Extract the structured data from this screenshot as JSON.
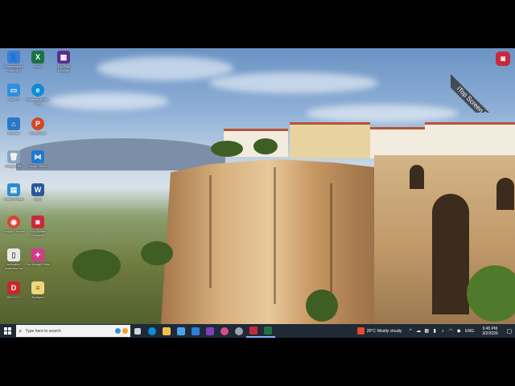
{
  "desktop": {
    "icons": [
      {
        "label": "Wondershare Filmora 9",
        "glyph": "👤",
        "color": "#3a7bd5",
        "icon": "filmora-icon"
      },
      {
        "label": "Excel",
        "glyph": "X",
        "color": "#1e7145",
        "icon": "excel-icon"
      },
      {
        "label": "iTop Easy Desktop",
        "glyph": "▦",
        "color": "#5b2d8e",
        "icon": "itop-easy-desktop-icon"
      },
      {
        "label": "This PC",
        "glyph": "▭",
        "color": "#2f8fdd",
        "icon": "computer-icon"
      },
      {
        "label": "Microsoft Edge - Copy",
        "glyph": "e",
        "color": "#0c8cd6",
        "icon": "edge-icon"
      },
      {
        "label": "Network",
        "glyph": "⌂",
        "color": "#2a78c6",
        "icon": "network-icon"
      },
      {
        "label": "PowerPoint",
        "glyph": "P",
        "color": "#d24726",
        "icon": "powerpoint-icon"
      },
      {
        "label": "Recycle Bin",
        "glyph": "🗑",
        "color": "#8aa4c2",
        "icon": "recycle-bin-icon"
      },
      {
        "label": "Visual Studio",
        "glyph": "⋈",
        "color": "#1f78d1",
        "icon": "visual-studio-icon"
      },
      {
        "label": "Control Panel",
        "glyph": "▤",
        "color": "#2b8bd1",
        "icon": "control-panel-icon"
      },
      {
        "label": "Word",
        "glyph": "W",
        "color": "#2b579a",
        "icon": "word-icon"
      },
      {
        "label": "Google Chrome",
        "glyph": "◉",
        "color": "#db4437",
        "icon": "chrome-icon"
      },
      {
        "label": "iTop Screen Recorder",
        "glyph": "◙",
        "color": "#c8283c",
        "icon": "itop-screen-recorder-icon"
      },
      {
        "label": "activation windows.bat",
        "glyph": "▯",
        "color": "#e8e8e8",
        "icon": "batch-file-icon"
      },
      {
        "label": "iTop Image Editor",
        "glyph": "✦",
        "color": "#d33a8c",
        "icon": "itop-image-editor-icon"
      },
      {
        "label": "DEV C++",
        "glyph": "D",
        "color": "#c62828",
        "icon": "dev-cpp-icon"
      },
      {
        "label": "Notepad",
        "glyph": "≡",
        "color": "#f0d77a",
        "icon": "notepad-icon"
      }
    ]
  },
  "watermark": {
    "text": "iTop Screen Recorder"
  },
  "taskbar": {
    "search_placeholder": "Type here to search",
    "pinned": [
      {
        "name": "task-view-button",
        "color": "#cfd8e3"
      },
      {
        "name": "edge-taskbar-button",
        "color": "#0c8cd6"
      },
      {
        "name": "file-explorer-taskbar-button",
        "color": "#f1c24b"
      },
      {
        "name": "store-taskbar-button",
        "color": "#4aa3e8"
      },
      {
        "name": "mail-taskbar-button",
        "color": "#2f7fd8"
      },
      {
        "name": "onenote-taskbar-button",
        "color": "#7b3fb8"
      },
      {
        "name": "itop-desktop-taskbar-button",
        "color": "#d94b8c"
      },
      {
        "name": "settings-taskbar-button",
        "color": "#9aa6b2"
      },
      {
        "name": "itop-recorder-taskbar-button",
        "color": "#c8283c"
      },
      {
        "name": "excel-taskbar-button",
        "color": "#1e7145"
      }
    ],
    "weather": {
      "temperature": "26°C",
      "condition": "Mostly cloudy"
    },
    "language": "ENG",
    "time": "6:45 PM",
    "date": "3/2/2026"
  }
}
